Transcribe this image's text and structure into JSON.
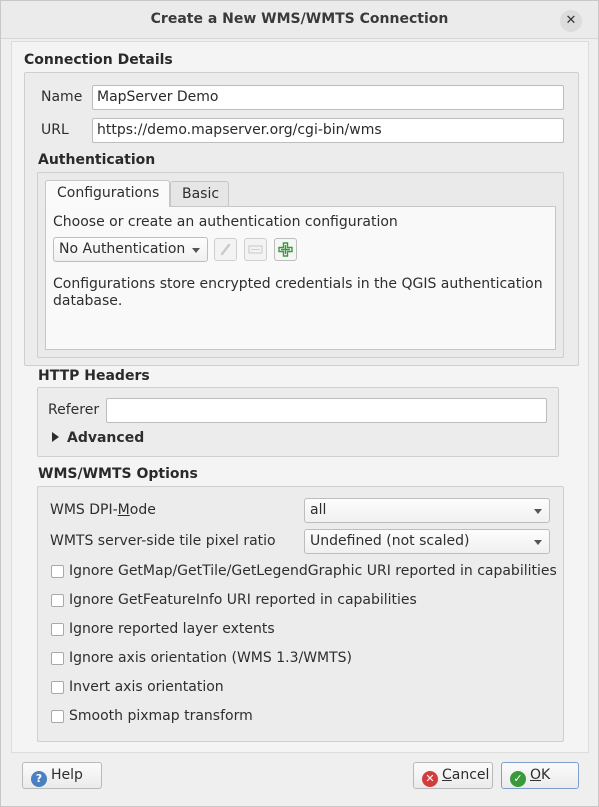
{
  "window": {
    "title": "Create a New WMS/WMTS Connection",
    "close_glyph": "✕"
  },
  "connection": {
    "heading": "Connection Details",
    "name_label": "Name",
    "name_value": "MapServer Demo",
    "url_label": "URL",
    "url_value": "https://demo.mapserver.org/cgi-bin/wms"
  },
  "authentication": {
    "heading": "Authentication",
    "tabs": [
      {
        "label": "Configurations",
        "active": true
      },
      {
        "label": "Basic",
        "active": false
      }
    ],
    "prompt": "Choose or create an authentication configuration",
    "selected_config": "No Authentication",
    "tool_icons": [
      "edit-icon",
      "clear-icon",
      "add-icon"
    ],
    "add_icon_color": "#3a9a3a",
    "description": "Configurations store encrypted credentials in the QGIS authentication database."
  },
  "http_headers": {
    "heading": "HTTP Headers",
    "referer_label": "Referer",
    "referer_value": "",
    "advanced_label": "Advanced"
  },
  "wms_options": {
    "heading": "WMS/WMTS Options",
    "dpi_mode_label_pre": "WMS DPI-",
    "dpi_mode_label_mnemonic": "M",
    "dpi_mode_label_post": "ode",
    "dpi_mode_value": "all",
    "tile_ratio_label": "WMTS server-side tile pixel ratio",
    "tile_ratio_value": "Undefined (not scaled)",
    "checkboxes": [
      {
        "label": "Ignore GetMap/GetTile/GetLegendGraphic URI reported in capabilities",
        "checked": false
      },
      {
        "label": "Ignore GetFeatureInfo URI reported in capabilities",
        "checked": false
      },
      {
        "label": "Ignore reported layer extents",
        "checked": false
      },
      {
        "label": "Ignore axis orientation (WMS 1.3/WMTS)",
        "checked": false
      },
      {
        "label": "Invert axis orientation",
        "checked": false
      },
      {
        "label": "Smooth pixmap transform",
        "checked": false
      }
    ]
  },
  "buttons": {
    "help": "Help",
    "cancel_mnemonic": "C",
    "cancel_rest": "ancel",
    "ok_mnemonic": "O",
    "ok_rest": "K",
    "help_icon_color": "#4a7fc1",
    "cancel_icon_color": "#d23c3c",
    "ok_icon_color": "#3a9a3a"
  }
}
